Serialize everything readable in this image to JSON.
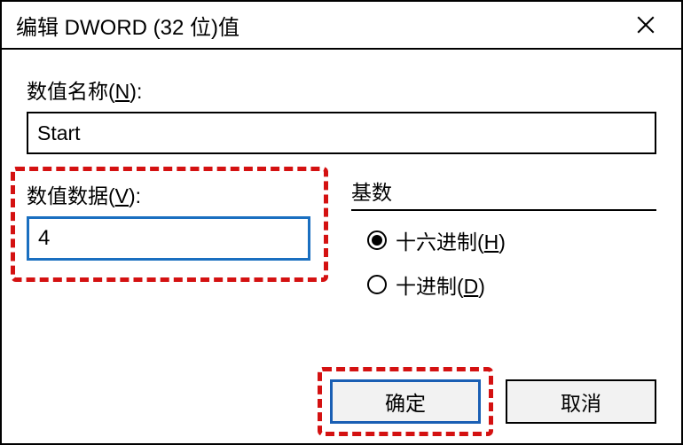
{
  "title": "编辑 DWORD (32 位)值",
  "name_section": {
    "label_prefix": "数值名称(",
    "label_key": "N",
    "label_suffix": "):",
    "value": "Start"
  },
  "data_section": {
    "label_prefix": "数值数据(",
    "label_key": "V",
    "label_suffix": "):",
    "value": "4"
  },
  "base_section": {
    "legend": "基数",
    "hex": {
      "prefix": "十六进制(",
      "key": "H",
      "suffix": ")",
      "checked": true
    },
    "dec": {
      "prefix": "十进制(",
      "key": "D",
      "suffix": ")",
      "checked": false
    }
  },
  "buttons": {
    "ok": "确定",
    "cancel": "取消"
  }
}
